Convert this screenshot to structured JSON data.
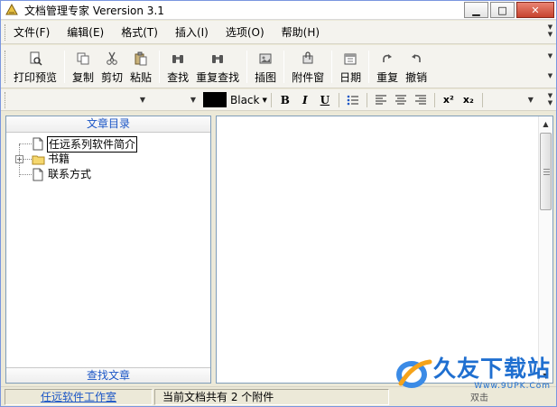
{
  "window": {
    "title": "文档管理专家 Verersion 3.1"
  },
  "menu": [
    "文件(F)",
    "编辑(E)",
    "格式(T)",
    "插入(I)",
    "选项(O)",
    "帮助(H)"
  ],
  "toolbar": {
    "print_preview": "打印预览",
    "copy": "复制",
    "cut": "剪切",
    "paste": "粘贴",
    "find": "查找",
    "find_again": "重复查找",
    "insert_image": "插图",
    "attachments": "附件窗",
    "date": "日期",
    "redo": "重复",
    "undo": "撤销"
  },
  "format": {
    "color_name": "Black",
    "bold": "B",
    "italic": "I",
    "underline": "U",
    "superscript": "x²",
    "subscript": "x₂"
  },
  "left_pane": {
    "header": "文章目录",
    "footer": "查找文章",
    "tree": [
      {
        "label": "任远系列软件简介",
        "type": "document",
        "selected": true
      },
      {
        "label": "书籍",
        "type": "folder",
        "expander": "+"
      },
      {
        "label": "联系方式",
        "type": "document"
      }
    ]
  },
  "status": {
    "studio_link": "任远软件工作室",
    "message": "当前文档共有 2 个附件",
    "hint": "双击"
  },
  "watermark": {
    "brand": "久友下载站",
    "url": "Www.9UPK.Com"
  },
  "colors": {
    "link": "#1a55c6",
    "accent": "#1f6fd0",
    "selection_border": "#000000"
  }
}
